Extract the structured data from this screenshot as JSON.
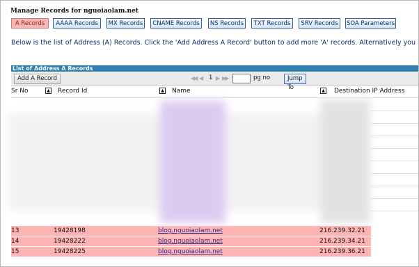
{
  "page": {
    "title": "Manage Records for nguoiaolam.net",
    "tabs": [
      {
        "label": "A Records",
        "active": true
      },
      {
        "label": "AAAA Records"
      },
      {
        "label": "MX Records"
      },
      {
        "label": "CNAME Records"
      },
      {
        "label": "NS Records"
      },
      {
        "label": "TXT Records"
      },
      {
        "label": "SRV Records"
      },
      {
        "label": "SOA Parameters"
      }
    ],
    "description": "Below is the list of Address (A) Records. Click the 'Add Address A Record' button to add more 'A' records. Alternatively you m"
  },
  "section": {
    "title": "List of Address A Records",
    "add_button": "Add A Record"
  },
  "pager": {
    "current_page": "1",
    "pg_label": "pg no",
    "input_value": "",
    "jump_button": "Jump To"
  },
  "table": {
    "headers": [
      "Sr No",
      "Record Id",
      "Name",
      "Destination IP Address"
    ],
    "sort_icon": "▲",
    "rows": [
      {
        "sr": "13",
        "id": "19428198",
        "name": "blog.nguoiaolam.net",
        "ip": "216.239.32.21"
      },
      {
        "sr": "14",
        "id": "19428222",
        "name": "blog.nguoiaolam.net",
        "ip": "216.239.34.21"
      },
      {
        "sr": "15",
        "id": "19428225",
        "name": "blog.nguoiaolam.net",
        "ip": "216.239.36.21"
      }
    ]
  },
  "colors": {
    "section_bar": "#2f7fb0",
    "highlight_row": "#ffb3b3",
    "active_tab": "#f7b7b7",
    "blur_name": "#d9c7f0"
  }
}
